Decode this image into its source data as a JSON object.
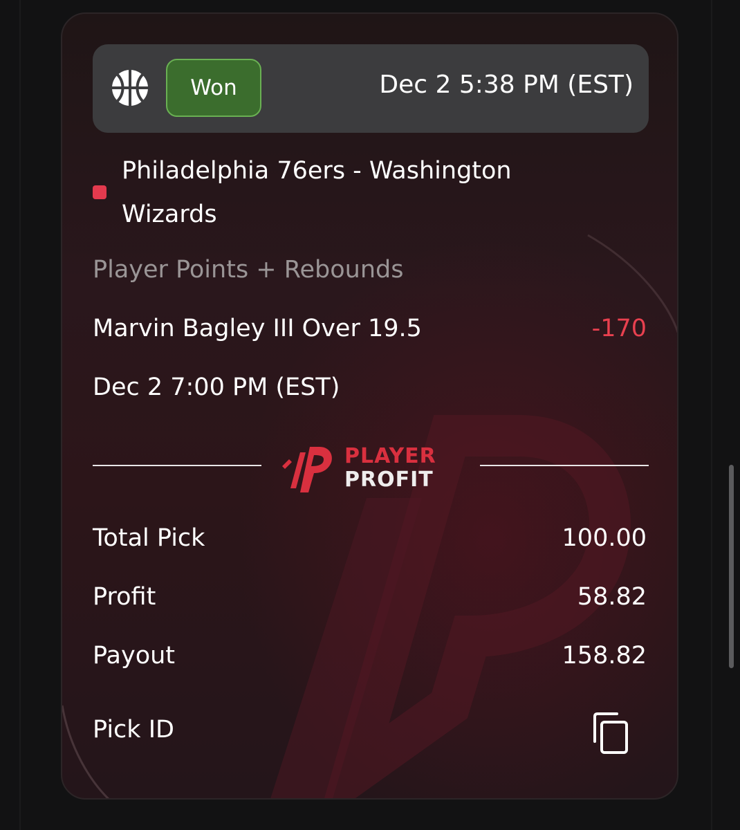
{
  "header": {
    "sport_icon": "basketball-icon",
    "status": "Won",
    "placed_time": "Dec 2 5:38 PM (EST)"
  },
  "event": {
    "matchup": "Philadelphia 76ers - Washington Wizards",
    "market": "Player Points + Rebounds",
    "selection": "Marvin Bagley III Over 19.5",
    "odds": "-170",
    "event_time": "Dec 2 7:00 PM (EST)"
  },
  "brand": {
    "line1": "PLAYER",
    "line2": "PROFIT"
  },
  "summary": {
    "total_pick_label": "Total Pick",
    "total_pick_value": "100.00",
    "profit_label": "Profit",
    "profit_value": "58.82",
    "payout_label": "Payout",
    "payout_value": "158.82",
    "pick_id_label": "Pick ID",
    "copy_icon": "copy-icon"
  },
  "colors": {
    "won_badge": "#3b6d2d",
    "won_border": "#6ab153",
    "odds_negative": "#e8404f",
    "brand_red": "#d9303f",
    "muted_text": "#9a9596"
  }
}
